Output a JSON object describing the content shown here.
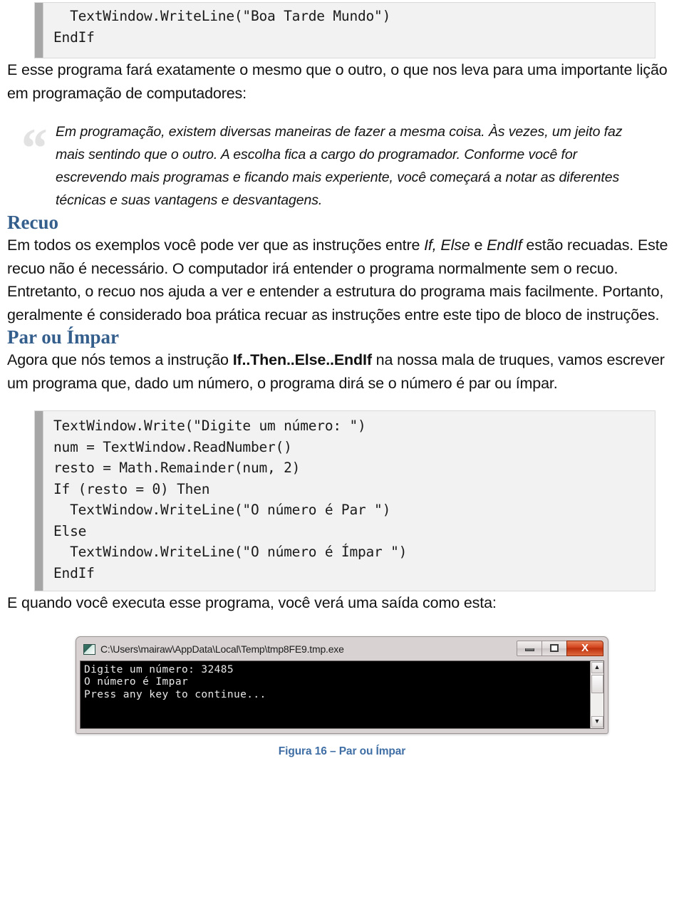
{
  "document": {
    "code_top": {
      "lines": [
        "  TextWindow.WriteLine(\"Boa Tarde Mundo\")",
        "EndIf"
      ]
    },
    "intro_paragraph": "E esse programa fará exatamente o mesmo que o outro, o que nos leva para uma importante lição em programação de computadores:",
    "quote": {
      "mark": "“",
      "text": "Em programação, existem diversas maneiras de fazer a mesma coisa.  Às vezes, um jeito faz mais sentindo que o outro.  A escolha fica a cargo do programador.  Conforme você for escrevendo mais programas e ficando mais experiente, você começará a notar as diferentes técnicas e suas vantagens e desvantagens."
    },
    "section_recuo": {
      "heading": "Recuo",
      "paragraph_part1": "Em todos os exemplos você pode ver que as instruções entre ",
      "paragraph_em1": "If, Else",
      "paragraph_part2": " e ",
      "paragraph_em2": "EndIf",
      "paragraph_part3": " estão recuadas.  Este recuo não é necessário.  O computador irá entender o programa normalmente sem o recuo.  Entretanto, o recuo nos ajuda a ver e entender a estrutura do programa mais facilmente.  Portanto, geralmente é considerado boa prática recuar as instruções entre este tipo de bloco de instruções."
    },
    "section_parimpar": {
      "heading": "Par ou Ímpar",
      "paragraph_part1": "Agora que nós temos a instrução ",
      "paragraph_bold": "If..Then..Else..EndIf",
      "paragraph_part2": " na nossa mala de truques, vamos escrever um programa que, dado um número, o programa dirá se o número é par ou ímpar.",
      "code": {
        "lines": [
          "TextWindow.Write(\"Digite um número: \")",
          "num = TextWindow.ReadNumber()",
          "resto = Math.Remainder(num, 2)",
          "If (resto = 0) Then",
          "  TextWindow.WriteLine(\"O número é Par \")",
          "Else",
          "  TextWindow.WriteLine(\"O número é Ímpar \")",
          "EndIf"
        ]
      },
      "output_paragraph": "E quando você executa esse programa, você verá uma saída como esta:"
    },
    "console": {
      "title": "C:\\Users\\mairaw\\AppData\\Local\\Temp\\tmp8FE9.tmp.exe",
      "minimize_label": "",
      "maximize_label": "",
      "close_label": "X",
      "scroll_up_label": "▲",
      "scroll_down_label": "▼",
      "output_lines": [
        "Digite um número: 32485",
        "O número é Impar",
        "Press any key to continue..."
      ]
    },
    "figure_caption": "Figura 16 – Par ou Ímpar",
    "colors": {
      "heading_blue": "#345e8c",
      "caption_blue": "#3f6ea5",
      "code_background": "#f2f2f2",
      "code_gutter": "#a6a6a6",
      "quote_mark_grey": "#e2e2e2",
      "console_background": "#000000",
      "console_close_red": "#d1401a"
    }
  }
}
